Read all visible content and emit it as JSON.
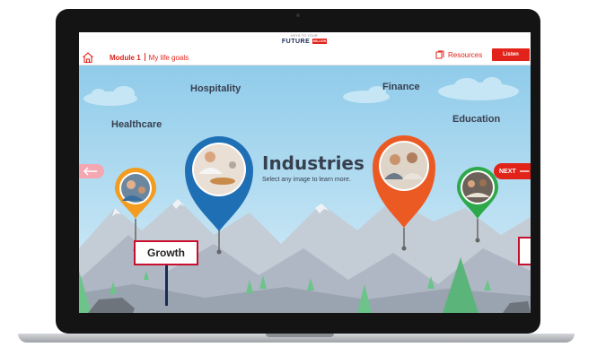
{
  "header": {
    "module_label": "Module 1",
    "page_title": "My life goals",
    "logo_line1": "KEYS TO YOUR",
    "logo_line2": "FUTURE",
    "logo_badge": "MILLION",
    "resources_label": "Resources",
    "listen_label": "Listen"
  },
  "main": {
    "title": "Industries",
    "subtitle": "Select any image to learn more.",
    "next_label": "NEXT",
    "sign_label": "Growth"
  },
  "pins": [
    {
      "label": "Healthcare",
      "color": "#f39c1f"
    },
    {
      "label": "Hospitality",
      "color": "#1f6fb5"
    },
    {
      "label": "Finance",
      "color": "#ec5a24"
    },
    {
      "label": "Education",
      "color": "#2ea84a"
    }
  ],
  "colors": {
    "brand": "#e2231a",
    "sky": "#9dd3ee",
    "text": "#384050",
    "mountain": "#b9c1cc"
  },
  "icons": [
    "home-icon",
    "resources-icon",
    "arrow-left-icon",
    "arrow-right-icon"
  ]
}
